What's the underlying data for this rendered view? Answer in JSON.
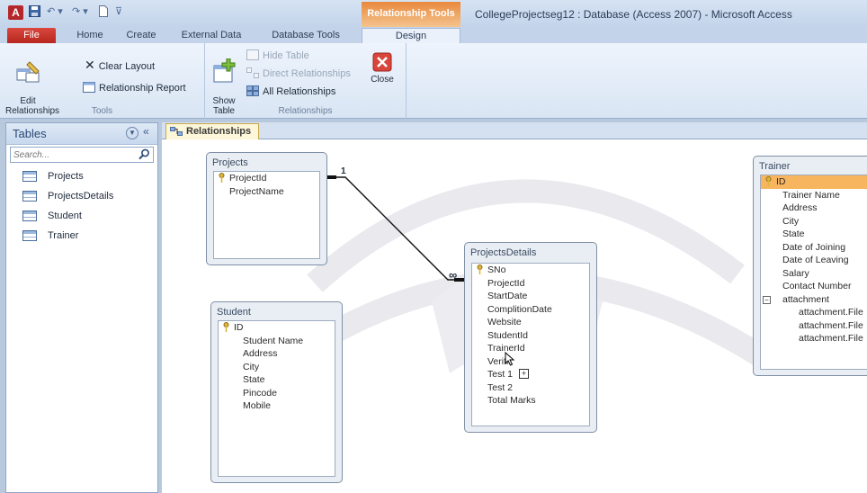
{
  "title_bar": {
    "app_icon": "A",
    "context_tab": "Relationship Tools",
    "window_title": "CollegeProjectseg12 : Database (Access 2007)  -  Microsoft Access"
  },
  "ribbon_tabs": [
    "File",
    "Home",
    "Create",
    "External Data",
    "Database Tools",
    "Design"
  ],
  "ribbon": {
    "tools": {
      "edit_relationships": "Edit\nRelationships",
      "clear_layout": "Clear Layout",
      "relationship_report": "Relationship Report",
      "label": "Tools"
    },
    "relationships": {
      "show_table": "Show\nTable",
      "hide_table": "Hide Table",
      "direct_relationships": "Direct Relationships",
      "all_relationships": "All Relationships",
      "close": "Close",
      "label": "Relationships"
    }
  },
  "nav_pane": {
    "title": "Tables",
    "search_placeholder": "Search...",
    "items": [
      "Projects",
      "ProjectsDetails",
      "Student",
      "Trainer"
    ]
  },
  "document": {
    "tab_label": "Relationships"
  },
  "diagram": {
    "projects": {
      "title": "Projects",
      "fields": [
        "ProjectId",
        "ProjectName"
      ]
    },
    "student": {
      "title": "Student",
      "fields": [
        "ID",
        "Student Name",
        "Address",
        "City",
        "State",
        "Pincode",
        "Mobile"
      ]
    },
    "projects_details": {
      "title": "ProjectsDetails",
      "fields": [
        "SNo",
        "ProjectId",
        "StartDate",
        "ComplitionDate",
        "Website",
        "StudentId",
        "TrainerId",
        "Verifi",
        "Test 1",
        "Test 2",
        "Total Marks"
      ]
    },
    "trainer": {
      "title": "Trainer",
      "fields": [
        "ID",
        "Trainer Name",
        "Address",
        "City",
        "State",
        "Date of Joining",
        "Date of Leaving",
        "Salary",
        "Contact Number",
        "attachment",
        "attachment.File",
        "attachment.File",
        "attachment.File"
      ]
    },
    "relationship": {
      "one_label": "1",
      "many_label": "∞"
    }
  },
  "colors": {
    "context_tab": "#e9893d",
    "file_tab": "#c63a31",
    "selected_field": "#f7b55f",
    "close_icon": "#d8453a"
  }
}
